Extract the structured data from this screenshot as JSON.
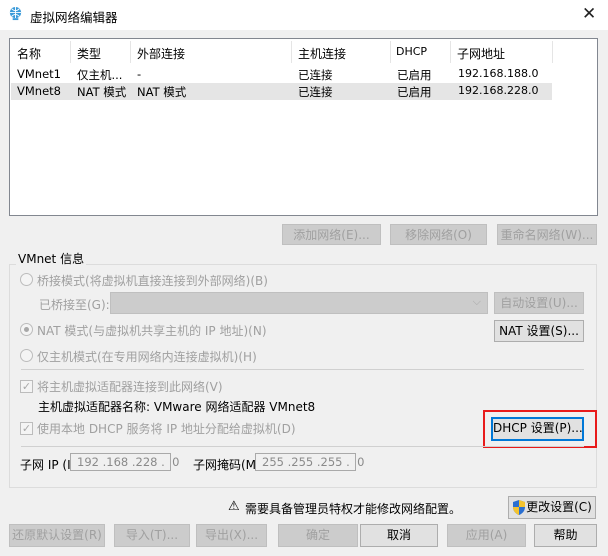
{
  "window": {
    "title": "虚拟网络编辑器",
    "close": "✕"
  },
  "table": {
    "headers": [
      "名称",
      "类型",
      "外部连接",
      "主机连接",
      "DHCP",
      "子网地址"
    ],
    "rows": [
      [
        "VMnet1",
        "仅主机...",
        "-",
        "已连接",
        "已启用",
        "192.168.188.0"
      ],
      [
        "VMnet8",
        "NAT 模式",
        "NAT 模式",
        "已连接",
        "已启用",
        "192.168.228.0"
      ]
    ]
  },
  "list_buttons": {
    "add": "添加网络(E)...",
    "remove": "移除网络(O)",
    "rename": "重命名网络(W)..."
  },
  "group": {
    "label": "VMnet 信息",
    "bridged": "桥接模式(将虚拟机直接连接到外部网络)(B)",
    "bridged_to": "已桥接至(G):",
    "auto_settings": "自动设置(U)...",
    "nat": "NAT 模式(与虚拟机共享主机的 IP 地址)(N)",
    "nat_settings": "NAT 设置(S)...",
    "host_only": "仅主机模式(在专用网络内连接虚拟机)(H)",
    "connect_adapter": "将主机虚拟适配器连接到此网络(V)",
    "adapter_name": "主机虚拟适配器名称: VMware 网络适配器 VMnet8",
    "use_dhcp": "使用本地 DHCP 服务将 IP 地址分配给虚拟机(D)",
    "dhcp_settings": "DHCP 设置(P)...",
    "subnet_ip_label": "子网 IP (I):",
    "subnet_ip": "192 .168 .228 .  0",
    "subnet_mask_label": "子网掩码(M):",
    "subnet_mask": "255 .255 .255 .  0"
  },
  "warning": {
    "icon": "⚠",
    "text": "需要具备管理员特权才能修改网络配置。",
    "change": "更改设置(C)"
  },
  "footer": {
    "restore": "还原默认设置(R)",
    "import": "导入(T)...",
    "export": "导出(X)...",
    "ok": "确定",
    "cancel": "取消",
    "apply": "应用(A)",
    "help": "帮助"
  },
  "colors": {
    "highlight": "#e81b1b",
    "focus": "#0078d7"
  }
}
